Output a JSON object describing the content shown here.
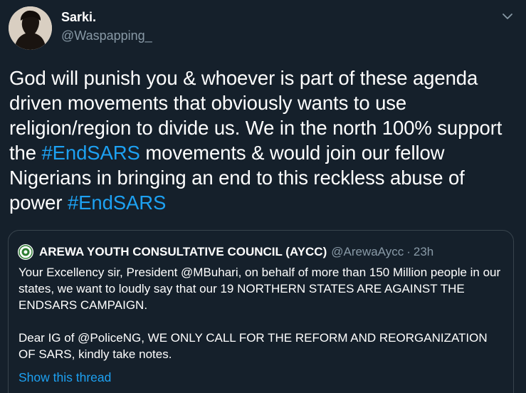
{
  "author": {
    "name": "Sarki.",
    "handle": "@Waspapping_",
    "avatar_icon": "profile-avatar-icon"
  },
  "tweet": {
    "text_before": "God will punish you & whoever is part of these agenda driven movements that obviously wants to use religion/region to divide us. We in the north 100% support the ",
    "hashtag1": "#EndSARS",
    "text_middle": " movements & would join our fellow Nigerians in bringing an end to this reckless abuse of power ",
    "hashtag2": "#EndSARS"
  },
  "quoted": {
    "name": "AREWA YOUTH CONSULTATIVE COUNCIL (AYCC)",
    "handle": "@ArewaAycc",
    "separator": "·",
    "time": "23h",
    "paragraph1": "Your Excellency sir, President @MBuhari, on behalf of more than 150 Million people in our states, we want to loudly say that our 19 NORTHERN STATES ARE AGAINST THE ENDSARS CAMPAIGN.",
    "paragraph2": "Dear IG of @PoliceNG, WE ONLY CALL FOR THE REFORM AND REORGANIZATION OF SARS, kindly take notes.",
    "show_thread": "Show this thread"
  },
  "colors": {
    "background": "#15202b",
    "link": "#1da1f2",
    "secondary_text": "#8899a6",
    "border": "#38444d"
  }
}
